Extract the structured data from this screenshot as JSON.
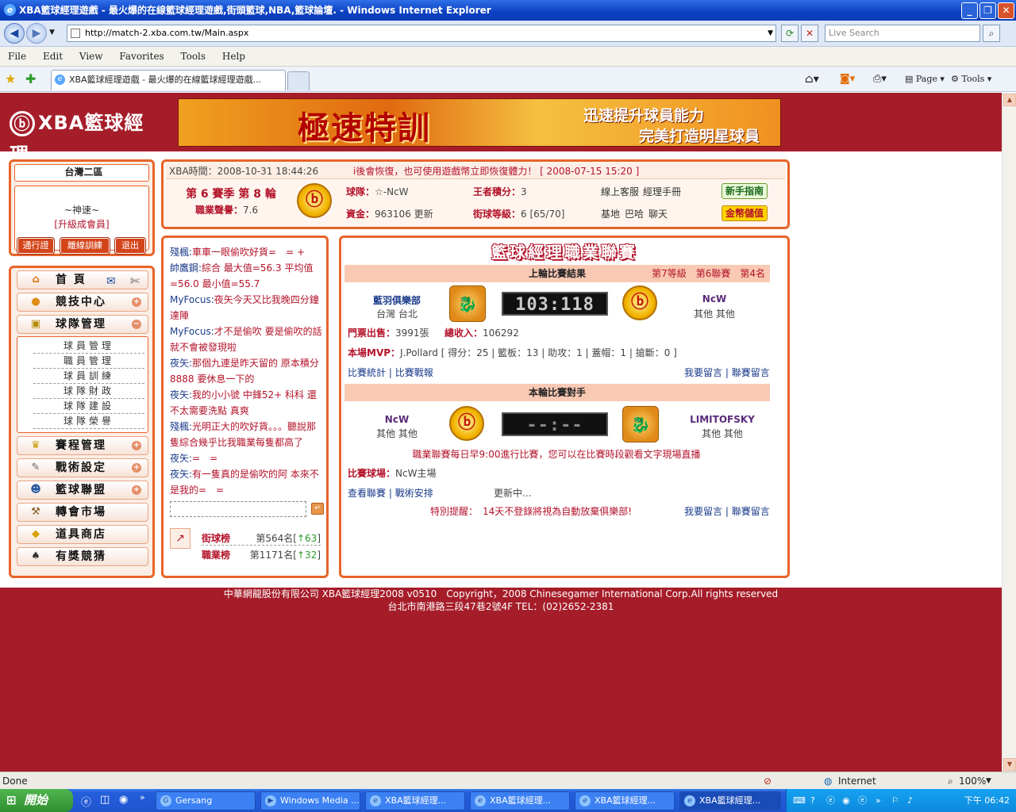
{
  "window": {
    "title": "XBA籃球經理遊戲 - 最火爆的在線籃球經理遊戲,街頭籃球,NBA,籃球論壇. - Windows Internet Explorer"
  },
  "browser": {
    "url": "http://match-2.xba.com.tw/Main.aspx",
    "search_placeholder": "Live Search",
    "menu": [
      "File",
      "Edit",
      "View",
      "Favorites",
      "Tools",
      "Help"
    ],
    "tab_title": "XBA籃球經理遊戲 - 最火爆的在線籃球經理遊戲...",
    "toolbar_page": "Page",
    "toolbar_tools": "Tools"
  },
  "site": {
    "logo_text": "XBA籃球經理",
    "banner_main": "極速特訓",
    "banner_line1": "迅速提升球員能力",
    "banner_line2": "完美打造明星球員"
  },
  "account": {
    "server": "台灣二區",
    "user": "~神速~",
    "level": "[升級成會員]",
    "buttons": [
      "通行證",
      "離線訓練",
      "退出"
    ]
  },
  "nav": {
    "home": "首 頁",
    "items": [
      {
        "label": "競技中心",
        "icon": "ball-icon"
      },
      {
        "label": "球隊管理",
        "icon": "clipboard-icon"
      },
      {
        "label": "賽程管理",
        "icon": "trophy-icon"
      },
      {
        "label": "戰術設定",
        "icon": "tactic-icon"
      },
      {
        "label": "籃球聯盟",
        "icon": "people-icon"
      },
      {
        "label": "轉會市場",
        "icon": "hammer-icon"
      },
      {
        "label": "道具商店",
        "icon": "gold-icon"
      },
      {
        "label": "有獎競猜",
        "icon": "spade-icon"
      }
    ],
    "team_submenu": [
      "球員管理",
      "職員管理",
      "球員訓練",
      "球隊財政",
      "球隊建設",
      "球隊榮譽"
    ]
  },
  "info": {
    "xba_time_label": "XBA時間：",
    "xba_time": "2008-10-31 18:44:26",
    "notice": "i後會恢復，也可使用遊戲幣立即恢復體力！ [ 2008-07-15 15:20 ]",
    "season": "第 6 賽季 第 8 輪",
    "pro_label": "職業聲譽：",
    "pro_value": "7.6",
    "team_label": "球隊：",
    "team_value": "☆-NcW",
    "king_label": "王者積分：",
    "king_value": "3",
    "cs": "線上客服",
    "manual": "經理手冊",
    "funds_label": "資金：",
    "funds_value": "963106",
    "refresh": "更新",
    "street_label": "街球等級：",
    "street_value": "6 [65/70]",
    "base": "基地",
    "bar": "巴哈",
    "chat": "聊天",
    "guide_btn": "新手指南",
    "gold_btn": "金幣儲值"
  },
  "chat": {
    "messages": [
      {
        "name": "殘楓:",
        "text": "車車一眼偷吹好貨=　= +"
      },
      {
        "name": "帥鷹鋼:",
        "text": "綜合 最大值=56.3 平均值=56.0 最小值=55.7"
      },
      {
        "name": "MyFocus:",
        "text": "夜矢今天又比我晚四分鐘達陣"
      },
      {
        "name": "MyFocus:",
        "text": "才不是偷吹 要是偷吹的話就不會被發現啦"
      },
      {
        "name": "夜矢:",
        "text": "那個九連是昨天留的 原本積分8888 要休息一下的"
      },
      {
        "name": "夜矢:",
        "text": "我的小小號 中鋒52+ 科科 還不太需要洗點 真爽"
      },
      {
        "name": "殘楓:",
        "text": "光明正大的吹好貨。。。聽說那隻綜合幾乎比我職業每隻都高了"
      },
      {
        "name": "夜矢:",
        "text": "=　="
      },
      {
        "name": "夜矢:",
        "text": "有一隻真的是偷吹的阿 本來不是我的=　="
      }
    ],
    "rank_street_label": "街球榜",
    "rank_street": "第564名[",
    "rank_street_up": "↑63",
    "rank_pro_label": "職業榜",
    "rank_pro": "第1171名[",
    "rank_pro_up": "↑32",
    "close_bracket": "]"
  },
  "league": {
    "title": "籃球經理職業聯賽",
    "last_header": "上輪比賽結果",
    "last_meta": "第7等級　第6聯賽　第4名",
    "home_team": "藍羽俱樂部",
    "home_loc": "台灣 台北",
    "score": "103:118",
    "away_team": "NcW",
    "away_loc": "其他 其他",
    "tickets_label": "門票出售：",
    "tickets": "3991張",
    "income_label": "總收入：",
    "income": "106292",
    "mvp_label": "本場MVP：",
    "mvp": "J.Pollard [ 得分：25 | 籃板：13 | 助攻：1 | 蓋帽：1 | 搶斷：0 ]",
    "stats_link": "比賽統計",
    "report_link": "比賽戰報",
    "msg_link": "我要留言",
    "league_msg_link": "聯賽留言",
    "next_header": "本輪比賽對手",
    "next_home": "NcW",
    "next_home_loc": "其他 其他",
    "next_score": "--:--",
    "next_away": "LIMITOFSKY",
    "next_away_loc": "其他 其他",
    "schedule_note": "職業聯賽每日早9:00進行比賽，您可以在比賽時段觀看文字現場直播",
    "venue_label": "比賽球場：",
    "venue": "NcW主場",
    "view_league": "查看聯賽",
    "tactics": "戰術安排",
    "updating": "更新中...",
    "warning_label": "特別提醒：",
    "warning": "14天不登錄將視為自動放棄俱樂部!"
  },
  "footer": {
    "line1": "中華網龍股份有限公司 XBA籃球經理2008 v0510　Copyright，2008 Chinesegamer International Corp.All rights reserved",
    "line2": "台北市南港路三段47巷2號4F TEL：(02)2652-2381"
  },
  "status": {
    "text": "Done",
    "zone": "Internet",
    "zoom": "100%"
  },
  "taskbar": {
    "start": "開始",
    "tasks": [
      "Gersang",
      "Windows Media ...",
      "XBA籃球經理...",
      "XBA籃球經理...",
      "XBA籃球經理...",
      "XBA籃球經理..."
    ],
    "clock": "下午 06:42"
  },
  "colors": {
    "site_bg": "#a61d2a",
    "accent": "#e8642a",
    "label_red": "#b3132a"
  }
}
